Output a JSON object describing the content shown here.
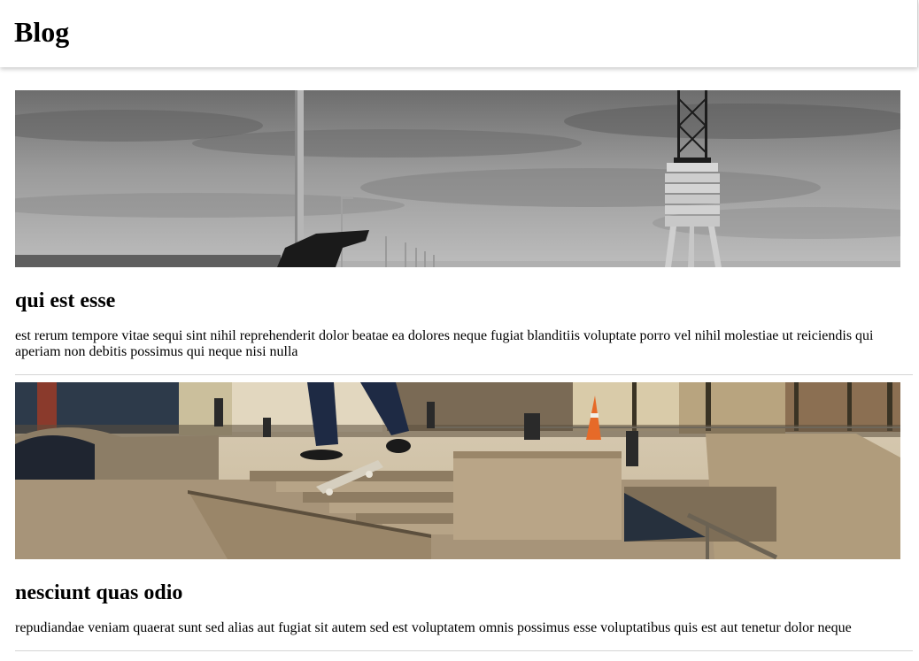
{
  "header": {
    "title": "Blog"
  },
  "posts": [
    {
      "image": "pier-lifeguard-tower-photo",
      "title": "qui est esse",
      "body": "est rerum tempore vitae sequi sint nihil reprehenderit dolor beatae ea dolores neque fugiat blanditiis voluptate porro vel nihil molestiae ut reiciendis qui aperiam non debitis possimus qui neque nisi nulla"
    },
    {
      "image": "skatepark-photo",
      "title": "nesciunt quas odio",
      "body": "repudiandae veniam quaerat sunt sed alias aut fugiat sit autem sed est voluptatem omnis possimus esse voluptatibus quis est aut tenetur dolor neque"
    }
  ],
  "colors": {
    "header_bg": "#ffffff",
    "divider": "#d4d4d4",
    "text": "#000000"
  }
}
